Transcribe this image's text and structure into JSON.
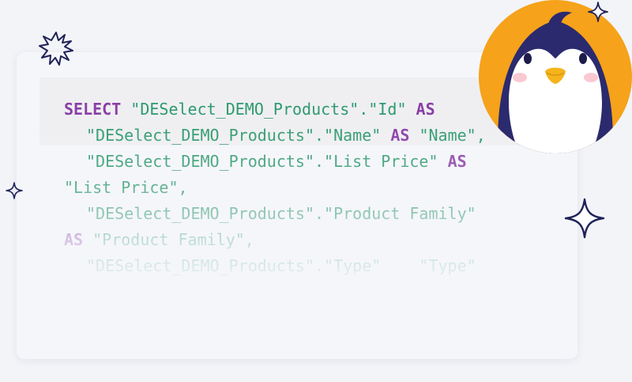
{
  "code": {
    "lines": [
      [
        {
          "t": "kw",
          "v": "SELECT"
        },
        {
          "t": "str",
          "v": " \"DESelect_DEMO_Products\".\"Id\" "
        },
        {
          "t": "kw",
          "v": "AS"
        }
      ],
      [
        {
          "t": "str",
          "v": "\"DESelect_DEMO_Products\".\"Name\" "
        },
        {
          "t": "kw",
          "v": "AS"
        },
        {
          "t": "str",
          "v": " \"Name\","
        }
      ],
      [
        {
          "t": "str",
          "v": "\"DESelect_DEMO_Products\".\"List Price\" "
        },
        {
          "t": "kw",
          "v": "AS"
        }
      ],
      [
        {
          "t": "str",
          "v": "\"List Price\","
        }
      ],
      [
        {
          "t": "str",
          "v": "\"DESelect_DEMO_Products\".\"Product Family\""
        }
      ],
      [
        {
          "t": "kw",
          "v": "AS"
        },
        {
          "t": "str",
          "v": " \"Product Family\","
        }
      ],
      [
        {
          "t": "str",
          "v": "\"DESelect_DEMO_Products\".\"Type\"    \"Type\""
        }
      ]
    ]
  },
  "colors": {
    "keyword": "#8a3fa6",
    "string": "#2f9a6d",
    "avatar_bg": "#f6a21a",
    "penguin_dark": "#2b2a6e",
    "sparkle": "#1f2257"
  },
  "icons": {
    "avatar": "penguin-avatar",
    "sparkles": [
      "starburst-icon",
      "sparkle-icon",
      "sparkle-icon",
      "sparkle-icon"
    ]
  }
}
